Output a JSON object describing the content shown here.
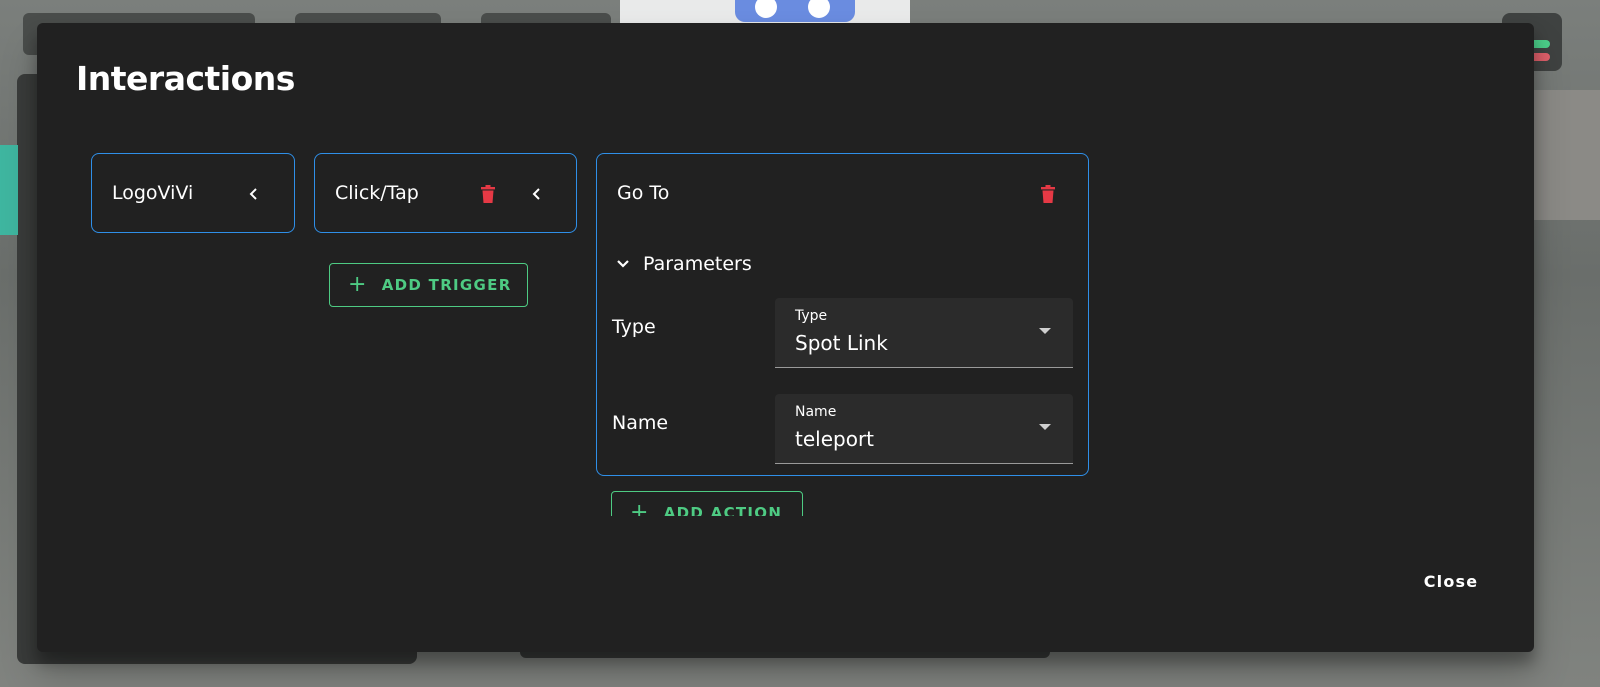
{
  "dialog": {
    "title": "Interactions",
    "close_label": "Close"
  },
  "object_card": {
    "label": "LogoViVi"
  },
  "trigger_card": {
    "label": "Click/Tap"
  },
  "add_trigger": {
    "label": "ADD TRIGGER"
  },
  "action_card": {
    "label": "Go To",
    "parameters_label": "Parameters",
    "params": [
      {
        "label": "Type",
        "field_label": "Type",
        "value": "Spot Link"
      },
      {
        "label": "Name",
        "field_label": "Name",
        "value": "teleport"
      }
    ]
  },
  "add_action": {
    "label": "ADD ACTION"
  },
  "colors": {
    "accent_border": "#2f8fe8",
    "add_green": "#4ecb83",
    "delete_red": "#e53945",
    "modal_bg": "#212121"
  },
  "icons": [
    "chevron-left-icon",
    "delete-icon",
    "chevron-down-icon",
    "plus-icon",
    "dropdown-arrow-icon"
  ]
}
